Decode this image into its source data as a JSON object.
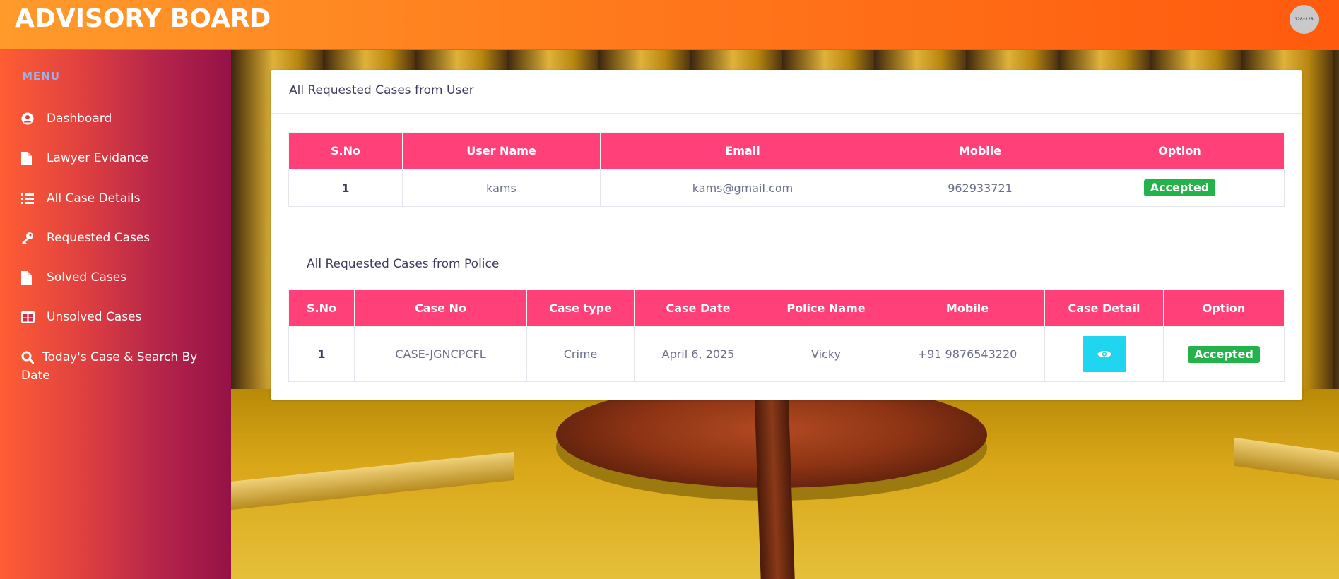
{
  "header": {
    "brand": "ADVISORY BOARD",
    "avatar_label": "128x128"
  },
  "sidebar": {
    "menu_title": "MENU",
    "items": [
      {
        "label": "Dashboard",
        "icon": "user-circle-icon"
      },
      {
        "label": "Lawyer Evidance",
        "icon": "file-icon"
      },
      {
        "label": "All Case Details",
        "icon": "list-icon"
      },
      {
        "label": "Requested Cases",
        "icon": "key-icon"
      },
      {
        "label": "Solved Cases",
        "icon": "file-icon"
      },
      {
        "label": "Unsolved Cases",
        "icon": "table-icon"
      },
      {
        "label": "Today's Case & Search By Date",
        "icon": "search-icon"
      }
    ]
  },
  "main": {
    "user_section": {
      "title": "All Requested Cases from User",
      "headers": [
        "S.No",
        "User Name",
        "Email",
        "Mobile",
        "Option"
      ],
      "rows": [
        {
          "sno": "1",
          "user_name": "kams",
          "email": "kams@gmail.com",
          "mobile": "962933721",
          "option": "Accepted"
        }
      ]
    },
    "police_section": {
      "title": "All Requested Cases from Police",
      "headers": [
        "S.No",
        "Case No",
        "Case type",
        "Case Date",
        "Police Name",
        "Mobile",
        "Case Detail",
        "Option"
      ],
      "rows": [
        {
          "sno": "1",
          "case_no": "CASE-JGNCPCFL",
          "case_type": "Crime",
          "case_date": "April 6, 2025",
          "police_name": "Vicky",
          "mobile": "+91 9876543220",
          "case_detail_icon": "eye-icon",
          "option": "Accepted"
        }
      ]
    }
  },
  "colors": {
    "header_accent": "#ff7a1c",
    "table_header": "#ff4079",
    "badge_success": "#23b34a",
    "view_button": "#1fd5ef"
  }
}
